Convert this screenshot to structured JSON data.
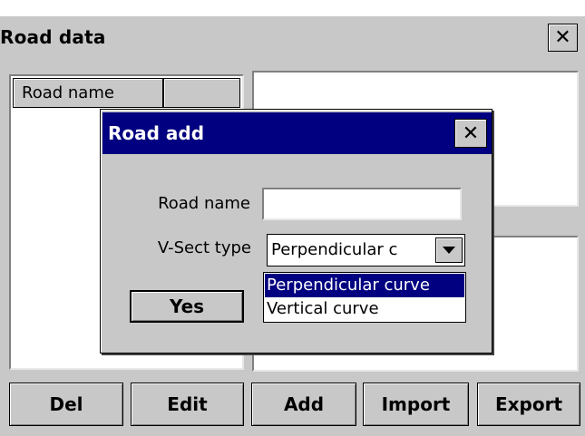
{
  "window": {
    "title": "Road data",
    "close_glyph": "✕"
  },
  "table": {
    "columns": [
      "Road name",
      ""
    ]
  },
  "buttons": {
    "del": "Del",
    "edit": "Edit",
    "add": "Add",
    "import": "Import",
    "export": "Export"
  },
  "dialog": {
    "title": "Road add",
    "close_glyph": "✕",
    "road_name_label": "Road name",
    "road_name_value": "",
    "vsect_label": "V-Sect type",
    "vsect_value": "Perpendicular c",
    "options": [
      "Perpendicular curve",
      "Vertical curve"
    ],
    "selected_option_index": 0,
    "yes_label": "Yes"
  },
  "colors": {
    "face": "#c8c8c8",
    "title_active": "#000080",
    "highlight": "#000080"
  }
}
